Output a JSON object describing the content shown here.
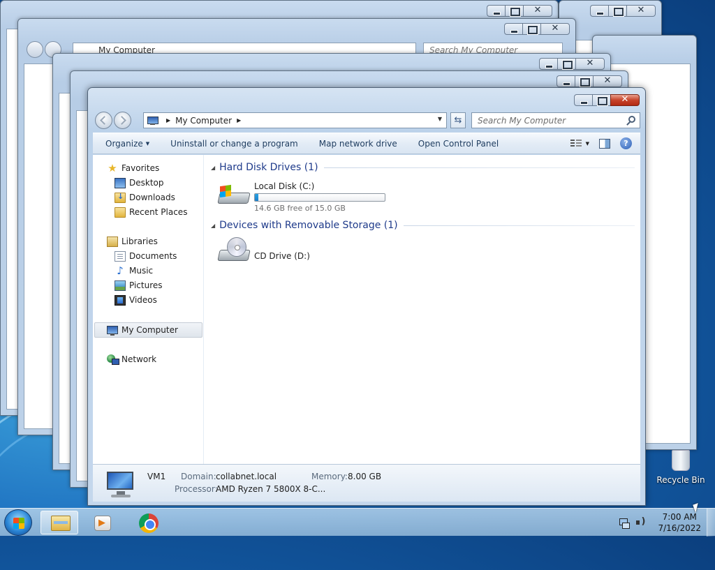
{
  "window": {
    "address_path": "My Computer",
    "search_placeholder": "Search My Computer"
  },
  "toolbar": {
    "organize": "Organize",
    "uninstall": "Uninstall or change a program",
    "map_drive": "Map network drive",
    "control_panel": "Open Control Panel"
  },
  "nav": {
    "favorites": "Favorites",
    "desktop": "Desktop",
    "downloads": "Downloads",
    "recent": "Recent Places",
    "libraries": "Libraries",
    "documents": "Documents",
    "music": "Music",
    "pictures": "Pictures",
    "videos": "Videos",
    "computer": "My Computer",
    "network": "Network"
  },
  "groups": {
    "hdd_header": "Hard Disk Drives (1)",
    "removable_header": "Devices with Removable Storage (1)"
  },
  "drives": {
    "c_name": "Local Disk (C:)",
    "c_free": "14.6 GB free of 15.0 GB",
    "c_used_fraction": 0.027,
    "d_name": "CD Drive (D:)"
  },
  "details": {
    "name": "VM1",
    "domain_label": "Domain:",
    "domain_value": "collabnet.local",
    "memory_label": "Memory:",
    "memory_value": "8.00 GB",
    "processor_label": "Processor:",
    "processor_value": "AMD Ryzen 7 5800X 8-C..."
  },
  "desktop": {
    "recycle_bin": "Recycle Bin"
  },
  "taskbar": {
    "time": "7:00 AM",
    "date": "7/16/2022"
  },
  "colors": {
    "accent": "#1e3a8a",
    "usage_bar": "#1c7fc9",
    "close_button": "#c7442b"
  }
}
